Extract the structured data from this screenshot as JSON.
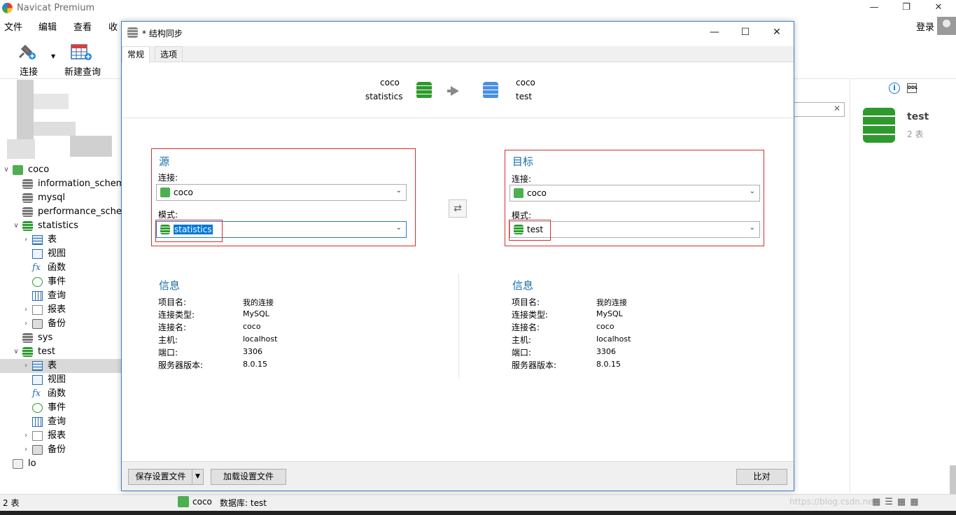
{
  "app": {
    "title": "Navicat Premium"
  },
  "menu": [
    "文件",
    "编辑",
    "查看",
    "收"
  ],
  "toolbar": {
    "connect": "连接",
    "new_query": "新建查询"
  },
  "account": {
    "login": "登录"
  },
  "tree": [
    {
      "label": "coco",
      "icon": "mysql-connection-icon",
      "indent": 0,
      "expanded": true
    },
    {
      "label": "information_schema",
      "icon": "database-icon",
      "indent": 1
    },
    {
      "label": "mysql",
      "icon": "database-icon",
      "indent": 1
    },
    {
      "label": "performance_schema",
      "icon": "database-icon",
      "indent": 1
    },
    {
      "label": "statistics",
      "icon": "database-active-icon",
      "indent": 1,
      "expanded": true
    },
    {
      "label": "表",
      "icon": "table-icon",
      "indent": 2,
      "collapsed": true
    },
    {
      "label": "视图",
      "icon": "view-icon",
      "indent": 2
    },
    {
      "label": "函数",
      "icon": "function-icon",
      "indent": 2
    },
    {
      "label": "事件",
      "icon": "event-icon",
      "indent": 2
    },
    {
      "label": "查询",
      "icon": "query-icon",
      "indent": 2
    },
    {
      "label": "报表",
      "icon": "report-icon",
      "indent": 2,
      "collapsed": true
    },
    {
      "label": "备份",
      "icon": "backup-icon",
      "indent": 2,
      "collapsed": true
    },
    {
      "label": "sys",
      "icon": "database-icon",
      "indent": 1
    },
    {
      "label": "test",
      "icon": "database-active-icon",
      "indent": 1,
      "expanded": true
    },
    {
      "label": "表",
      "icon": "table-icon",
      "indent": 2,
      "collapsed": true,
      "selected": true
    },
    {
      "label": "视图",
      "icon": "view-icon",
      "indent": 2
    },
    {
      "label": "函数",
      "icon": "function-icon",
      "indent": 2
    },
    {
      "label": "事件",
      "icon": "event-icon",
      "indent": 2
    },
    {
      "label": "查询",
      "icon": "query-icon",
      "indent": 2
    },
    {
      "label": "报表",
      "icon": "report-icon",
      "indent": 2,
      "collapsed": true
    },
    {
      "label": "备份",
      "icon": "backup-icon",
      "indent": 2,
      "collapsed": true
    },
    {
      "label": "lo",
      "icon": "mysql-connection-gray-icon",
      "indent": 0
    }
  ],
  "right_panel": {
    "name": "test",
    "count": "2 表"
  },
  "status": {
    "count": "2 表",
    "connection": "coco",
    "database": "数据库: test",
    "watermark": "https://blog.csdn.net"
  },
  "dialog": {
    "title": "* 结构同步",
    "tabs": [
      "常规",
      "选项"
    ],
    "header": {
      "source_conn": "coco",
      "source_schema": "statistics",
      "target_conn": "coco",
      "target_schema": "test"
    },
    "source": {
      "title": "源",
      "conn_label": "连接:",
      "conn_value": "coco",
      "schema_label": "模式:",
      "schema_value": "statistics"
    },
    "target": {
      "title": "目标",
      "conn_label": "连接:",
      "conn_value": "coco",
      "schema_label": "模式:",
      "schema_value": "test"
    },
    "source_info": {
      "title": "信息",
      "rows": [
        {
          "k": "项目名:",
          "v": "我的连接"
        },
        {
          "k": "连接类型:",
          "v": "MySQL"
        },
        {
          "k": "连接名:",
          "v": "coco"
        },
        {
          "k": "主机:",
          "v": "localhost"
        },
        {
          "k": "端口:",
          "v": "3306"
        },
        {
          "k": "服务器版本:",
          "v": "8.0.15"
        }
      ]
    },
    "target_info": {
      "title": "信息",
      "rows": [
        {
          "k": "项目名:",
          "v": "我的连接"
        },
        {
          "k": "连接类型:",
          "v": "MySQL"
        },
        {
          "k": "连接名:",
          "v": "coco"
        },
        {
          "k": "主机:",
          "v": "localhost"
        },
        {
          "k": "端口:",
          "v": "3306"
        },
        {
          "k": "服务器版本:",
          "v": "8.0.15"
        }
      ]
    },
    "buttons": {
      "save_profile": "保存设置文件",
      "load_profile": "加载设置文件",
      "compare": "比对"
    }
  },
  "colors": {
    "accent_blue": "#1a6ea8",
    "highlight_red": "#d32f2f",
    "db_green": "#2e9a2e",
    "db_blue": "#4a90e2"
  }
}
